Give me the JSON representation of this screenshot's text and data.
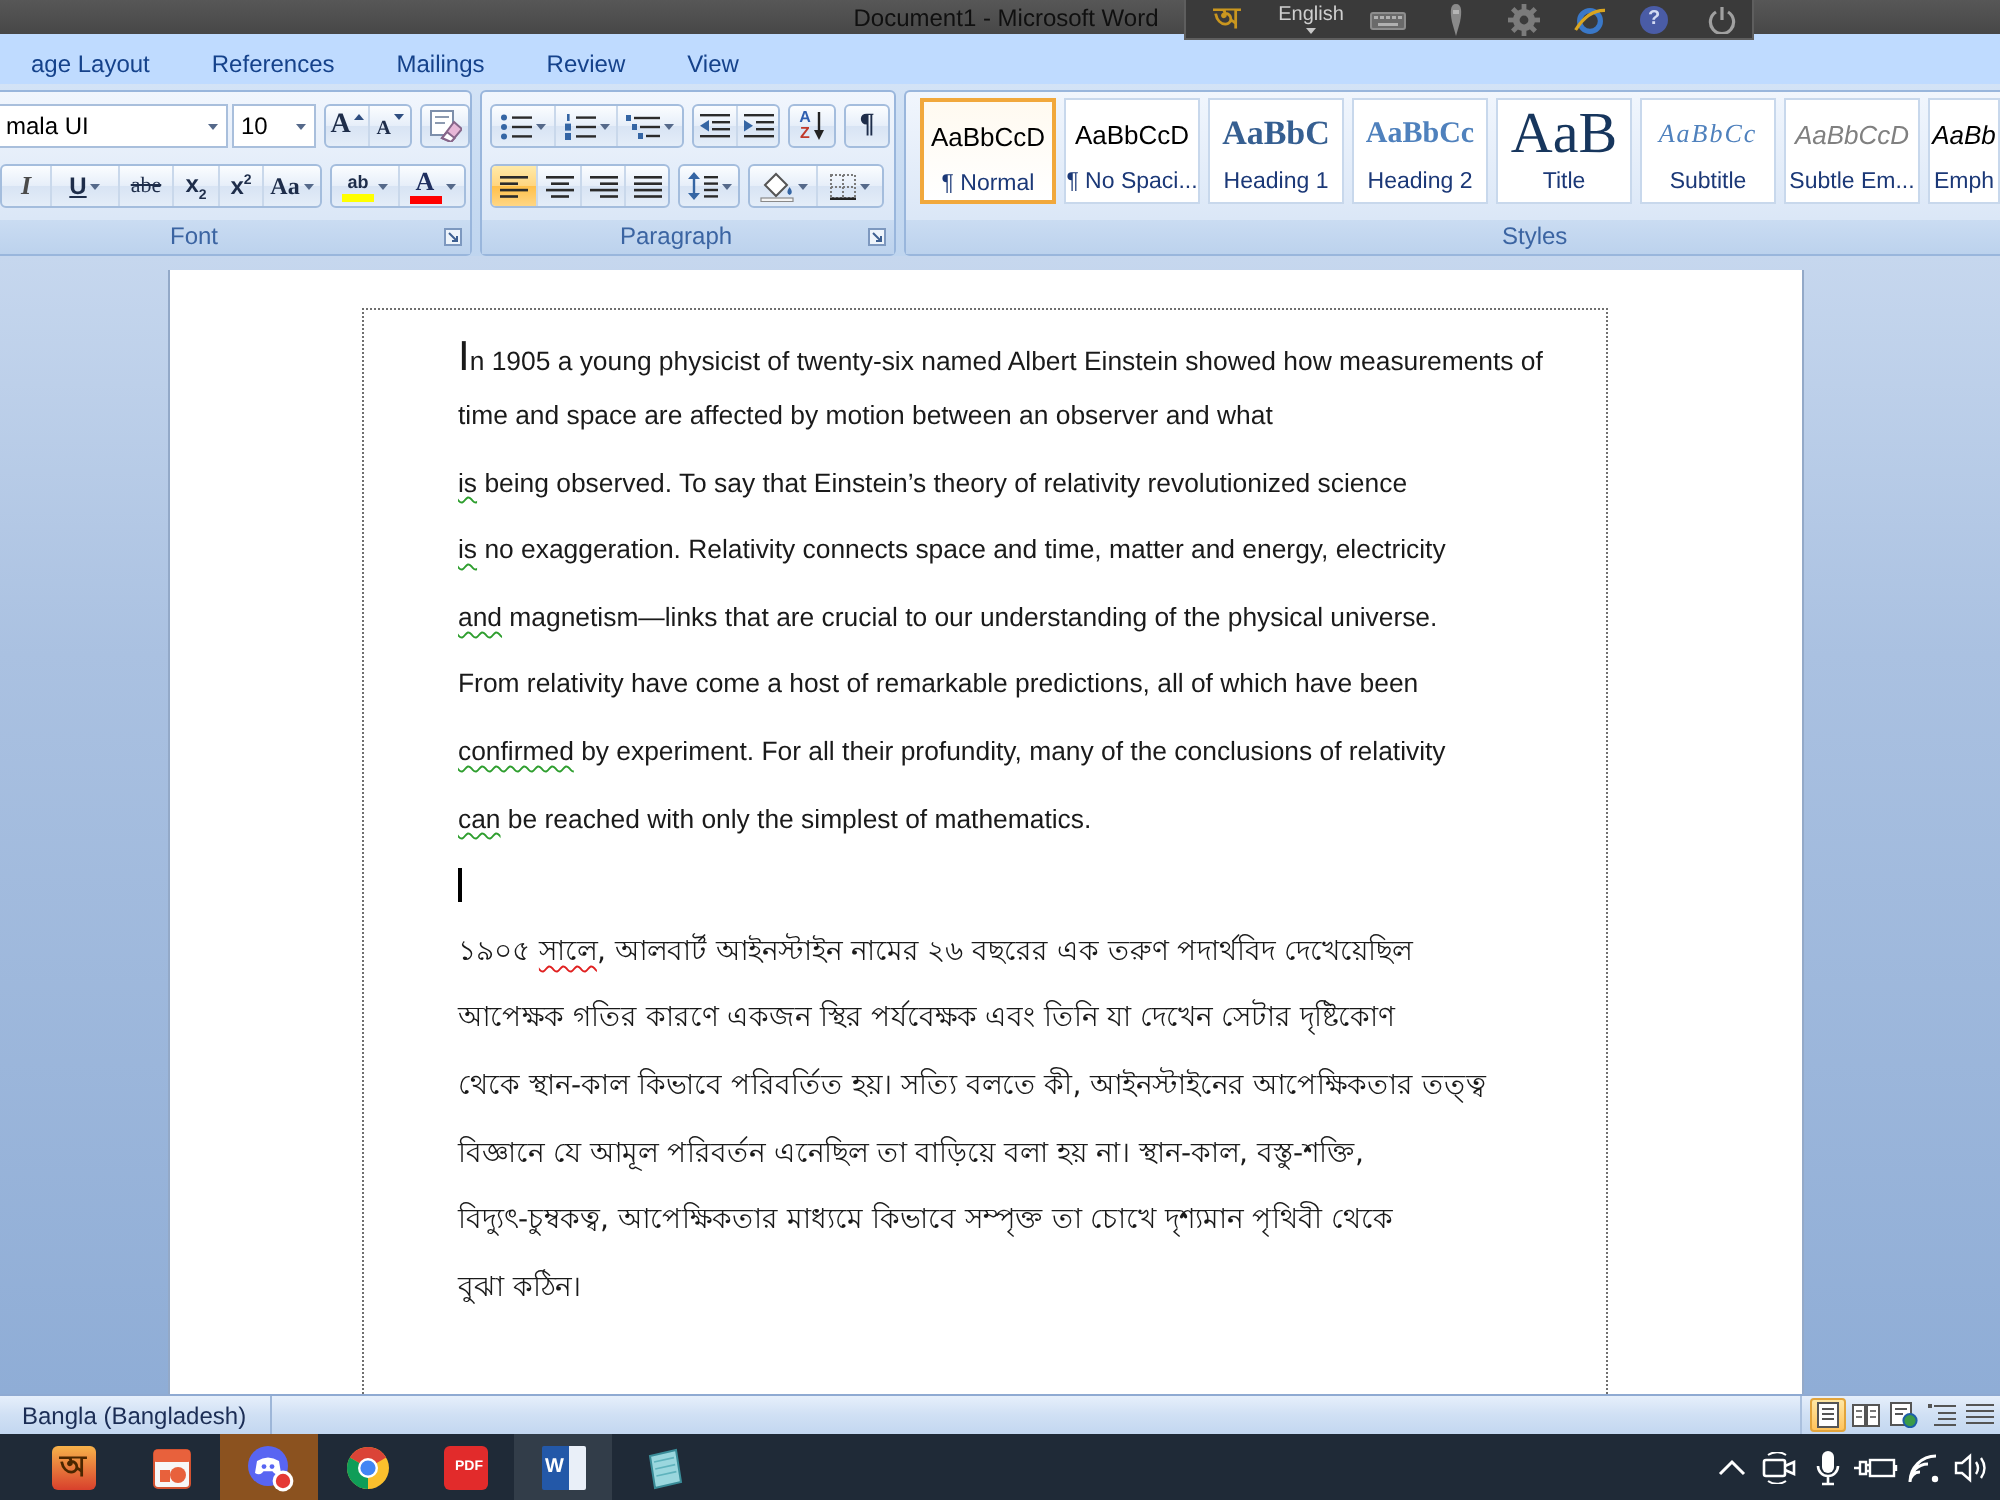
{
  "title_bar": {
    "title": "Document1 - Microsoft Word"
  },
  "language_bar": {
    "input_glyph": "অ",
    "language": "English",
    "tools": [
      {
        "kind": "keyboard"
      },
      {
        "kind": "pen"
      },
      {
        "kind": "settings"
      },
      {
        "kind": "browser"
      },
      {
        "kind": "help",
        "glyph": "?"
      },
      {
        "kind": "power"
      }
    ]
  },
  "ribbon": {
    "tabs": [
      {
        "label": "age Layout",
        "selected": false
      },
      {
        "label": "References",
        "selected": false
      },
      {
        "label": "Mailings",
        "selected": false
      },
      {
        "label": "Review",
        "selected": false
      },
      {
        "label": "View",
        "selected": false
      }
    ],
    "font_group": {
      "label": "Font",
      "font_name": "mala UI",
      "font_size": "10",
      "launcher": true,
      "top_clusters": [
        {
          "buttons": [
            {
              "kind": "grow-font",
              "glyph": "A"
            },
            {
              "kind": "shrink-font",
              "glyph": "A"
            }
          ]
        },
        {
          "buttons": [
            {
              "kind": "clear-format"
            }
          ]
        }
      ],
      "bottom_clusters": [
        {
          "buttons": [
            {
              "kind": "italic",
              "glyph": "I"
            },
            {
              "kind": "underline",
              "glyph": "U",
              "dropdown": true
            },
            {
              "kind": "strikethrough",
              "glyph": "abe"
            },
            {
              "kind": "subscript",
              "glyph": "x$_{2}$"
            },
            {
              "kind": "superscript",
              "glyph": "x$^{2}$"
            },
            {
              "kind": "change-case",
              "glyph": "Aa",
              "dropdown": true
            }
          ]
        },
        {
          "buttons": [
            {
              "kind": "highlight",
              "glyph": "ab",
              "color": "#ffff00",
              "dropdown": true
            },
            {
              "kind": "font-color",
              "glyph": "A",
              "color": "#ff0000",
              "dropdown": true
            }
          ]
        }
      ]
    },
    "paragraph_group": {
      "label": "Paragraph",
      "launcher": true,
      "top_clusters": [
        {
          "buttons": [
            {
              "kind": "bullets",
              "dropdown": true
            },
            {
              "kind": "numbering",
              "dropdown": true
            },
            {
              "kind": "multilevel",
              "dropdown": true
            }
          ]
        },
        {
          "buttons": [
            {
              "kind": "decrease-indent"
            },
            {
              "kind": "increase-indent"
            }
          ]
        },
        {
          "buttons": [
            {
              "kind": "sort",
              "glyph": "AZ"
            }
          ]
        },
        {
          "buttons": [
            {
              "kind": "show-marks",
              "glyph": "¶"
            }
          ]
        }
      ],
      "bottom_clusters": [
        {
          "buttons": [
            {
              "kind": "align-left",
              "selected": true
            },
            {
              "kind": "align-center",
              "selected": false
            },
            {
              "kind": "align-right",
              "selected": false
            },
            {
              "kind": "justify",
              "selected": false
            }
          ]
        },
        {
          "buttons": [
            {
              "kind": "line-spacing",
              "dropdown": true
            }
          ]
        },
        {
          "buttons": [
            {
              "kind": "shading",
              "dropdown": true
            },
            {
              "kind": "borders",
              "dropdown": true
            }
          ]
        }
      ]
    },
    "styles_group": {
      "label": "Styles",
      "styles": [
        {
          "kind": "normal",
          "preview": "AaBbCcD",
          "name": "¶ Normal",
          "selected": true
        },
        {
          "kind": "normal",
          "preview": "AaBbCcD",
          "name": "¶ No Spaci...",
          "selected": false
        },
        {
          "kind": "heading1",
          "preview": "AaBbC",
          "name": "Heading 1",
          "selected": false
        },
        {
          "kind": "heading2",
          "preview": "AaBbCc",
          "name": "Heading 2",
          "selected": false
        },
        {
          "kind": "title",
          "preview": "AaB",
          "name": "Title",
          "selected": false
        },
        {
          "kind": "subtitle",
          "preview": "AaBbCc",
          "name": "Subtitle",
          "selected": false
        },
        {
          "kind": "subtle",
          "preview": "AaBbCcD",
          "name": "Subtle Em...",
          "selected": false
        },
        {
          "kind": "emphasis",
          "preview": "AaBb",
          "name": "Emph",
          "selected": false
        }
      ]
    }
  },
  "document": {
    "paragraphs": [
      {
        "kind": "latin",
        "large_initial": true,
        "lines": [
          {
            "segments": [
              {
                "text": "In 1905 a young physicist of twenty-six named Albert Einstein showed how measurements of"
              }
            ]
          },
          {
            "segments": [
              {
                "text": "time and space are affected by motion between an observer and what"
              }
            ]
          }
        ]
      },
      {
        "kind": "latin",
        "lines": [
          {
            "segments": [
              {
                "text": "is",
                "grammar_error": true
              },
              {
                "text": " being observed. To say that Einstein’s theory of relativity revolutionized science"
              }
            ]
          }
        ]
      },
      {
        "kind": "latin",
        "lines": [
          {
            "segments": [
              {
                "text": "is",
                "grammar_error": true
              },
              {
                "text": " no exaggeration. Relativity connects space and time, matter and energy, electricity"
              }
            ]
          }
        ]
      },
      {
        "kind": "latin",
        "lines": [
          {
            "segments": [
              {
                "text": "and",
                "grammar_error": true
              },
              {
                "text": " magnetism—links that are crucial to our understanding of the physical universe."
              }
            ]
          }
        ]
      },
      {
        "kind": "latin",
        "lines": [
          {
            "segments": [
              {
                "text": "From relativity have come a host of remarkable predictions, all of which have been"
              }
            ]
          }
        ]
      },
      {
        "kind": "latin",
        "lines": [
          {
            "segments": [
              {
                "text": "confirmed",
                "grammar_error": true
              },
              {
                "text": " by experiment. For all their profundity, many of the conclusions of relativity"
              }
            ]
          }
        ]
      },
      {
        "kind": "latin",
        "lines": [
          {
            "segments": [
              {
                "text": "can",
                "grammar_error": true
              },
              {
                "text": " be reached with only the simplest of mathematics."
              }
            ]
          }
        ]
      },
      {
        "kind": "cursor"
      },
      {
        "kind": "bengali",
        "lines": [
          {
            "segments": [
              {
                "text": "১৯০৫ "
              },
              {
                "text": "সালে",
                "spelling_error": true
              },
              {
                "text": ", আলবার্ট আইনস্টাইন নামের ২৬ বছরের এক তরুণ পদার্থবিদ দেখেয়েছিল"
              }
            ]
          }
        ]
      },
      {
        "kind": "bengali",
        "lines": [
          {
            "segments": [
              {
                "text": "আপেক্ষক গতির কারণে একজন স্থির পর্যবেক্ষক এবং তিনি যা দেখেন সেটার দৃষ্টিকোণ"
              }
            ]
          }
        ]
      },
      {
        "kind": "bengali",
        "lines": [
          {
            "segments": [
              {
                "text": "থেকে স্থান-কাল কিভাবে পরিবর্তিত হয়। সত্যি বলতে কী, আইনস্টাইনের আপেক্ষিকতার তত্ত্ব"
              }
            ]
          }
        ]
      },
      {
        "kind": "bengali",
        "lines": [
          {
            "segments": [
              {
                "text": "বিজ্ঞানে যে আমূল পরিবর্তন এনেছিল তা বাড়িয়ে বলা হয় না। স্থান-কাল, বস্তু-শক্তি,"
              }
            ]
          }
        ]
      },
      {
        "kind": "bengali",
        "lines": [
          {
            "segments": [
              {
                "text": "বিদ্যুৎ-চুম্বকত্ব, আপেক্ষিকতার মাধ্যমে কিভাবে সম্পৃক্ত তা চোখে দৃশ্যমান পৃথিবী থেকে"
              }
            ]
          }
        ]
      },
      {
        "kind": "bengali",
        "lines": [
          {
            "segments": [
              {
                "text": "বুঝা কঠিন।"
              }
            ]
          }
        ]
      }
    ]
  },
  "status_bar": {
    "language": "Bangla (Bangladesh)",
    "views": [
      {
        "kind": "print-layout",
        "selected": true
      },
      {
        "kind": "reading",
        "selected": false
      },
      {
        "kind": "web-layout",
        "selected": false
      },
      {
        "kind": "outline",
        "selected": false
      },
      {
        "kind": "draft",
        "selected": false
      }
    ]
  },
  "taskbar": {
    "apps": [
      {
        "kind": "bangla-keyboard",
        "glyph": "অ",
        "active": false,
        "flashing": false
      },
      {
        "kind": "presentation",
        "active": false,
        "flashing": false
      },
      {
        "kind": "chat",
        "active": false,
        "flashing": true
      },
      {
        "kind": "browser",
        "active": false,
        "flashing": false
      },
      {
        "kind": "pdf",
        "glyph": "PDF",
        "active": false,
        "flashing": false
      },
      {
        "kind": "word",
        "glyph": "W",
        "active": true,
        "flashing": false
      },
      {
        "kind": "notepad",
        "active": false,
        "flashing": false
      }
    ],
    "tray": [
      {
        "kind": "chevron"
      },
      {
        "kind": "camera"
      },
      {
        "kind": "microphone"
      },
      {
        "kind": "battery"
      },
      {
        "kind": "wifi"
      },
      {
        "kind": "volume"
      }
    ]
  }
}
